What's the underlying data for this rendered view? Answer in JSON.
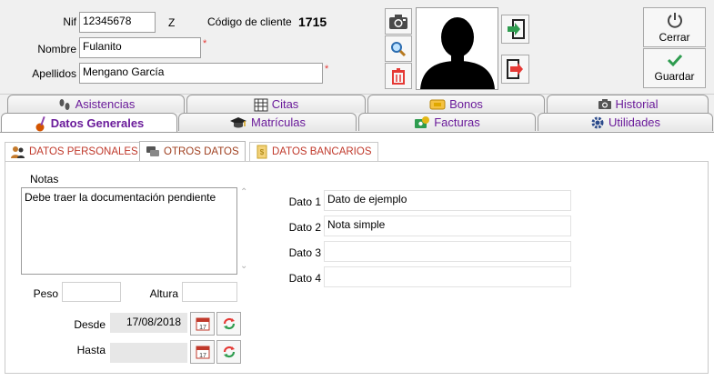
{
  "header": {
    "nif_label": "Nif",
    "nif_value": "12345678",
    "nif_letter": "Z",
    "client_code_label": "Código de cliente",
    "client_code_value": "1715",
    "nombre_label": "Nombre",
    "nombre_value": "Fulanito",
    "apellidos_label": "Apellidos",
    "apellidos_value": "Mengano García",
    "required_mark": "*"
  },
  "actions": {
    "close_label": "Cerrar",
    "save_label": "Guardar"
  },
  "tabs_row1": [
    "Asistencias",
    "Citas",
    "Bonos",
    "Historial"
  ],
  "tabs_row2": [
    "Datos Generales",
    "Matrículas",
    "Facturas",
    "Utilidades"
  ],
  "subtabs": [
    "DATOS PERSONALES",
    "OTROS DATOS",
    "DATOS BANCARIOS"
  ],
  "form": {
    "notas_label": "Notas",
    "notas_value": "Debe traer la documentación pendiente",
    "peso_label": "Peso",
    "peso_value": "",
    "altura_label": "Altura",
    "altura_value": "",
    "desde_label": "Desde",
    "desde_value": "17/08/2018",
    "hasta_label": "Hasta",
    "hasta_value": "",
    "calendar_day": "17",
    "datos": [
      {
        "label": "Dato 1",
        "value": "Dato de ejemplo"
      },
      {
        "label": "Dato 2",
        "value": "Nota simple"
      },
      {
        "label": "Dato 3",
        "value": ""
      },
      {
        "label": "Dato 4",
        "value": ""
      }
    ]
  },
  "colors": {
    "tab_text": "#6a1b9a",
    "subtab_text": "#c0392b",
    "required": "#e53935",
    "save_check": "#2e9c4f",
    "delete_icon": "#e53935"
  }
}
